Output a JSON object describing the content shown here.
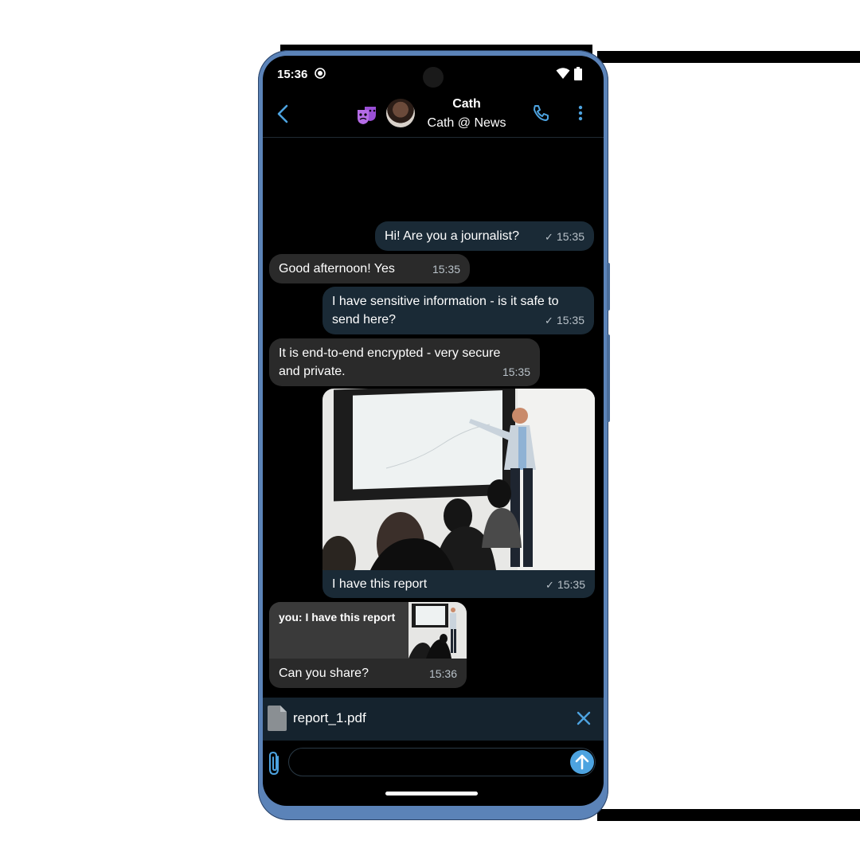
{
  "status": {
    "time": "15:36"
  },
  "header": {
    "contact_name": "Cath",
    "contact_subtitle": "Cath @ News"
  },
  "messages": [
    {
      "direction": "out",
      "text": "Hi! Are you a journalist?",
      "time": "15:35",
      "status": "sent"
    },
    {
      "direction": "in",
      "text": "Good afternoon! Yes",
      "time": "15:35"
    },
    {
      "direction": "out",
      "text": "I have sensitive information - is it safe to send here?",
      "time": "15:35",
      "status": "sent"
    },
    {
      "direction": "in",
      "text": "It is end-to-end encrypted - very secure and private.",
      "time": "15:35"
    },
    {
      "direction": "out",
      "type": "image",
      "text": "I have this report",
      "time": "15:35",
      "status": "sent"
    },
    {
      "direction": "in",
      "quote": "you: I have this report",
      "text": "Can you share?",
      "time": "15:36"
    }
  ],
  "attachment": {
    "file_name": "report_1.pdf"
  },
  "composer": {
    "placeholder": ""
  },
  "colors": {
    "background": "#000000",
    "outgoing_bubble": "#1a2a36",
    "incoming_bubble": "#2a2a2a",
    "accent": "#4da3e0",
    "incognito": "#b56ce6"
  },
  "icons": [
    "back-icon",
    "incognito-icon",
    "avatar",
    "call-icon",
    "more-icon",
    "check-icon",
    "file-icon",
    "close-icon",
    "paperclip-icon",
    "send-icon"
  ]
}
